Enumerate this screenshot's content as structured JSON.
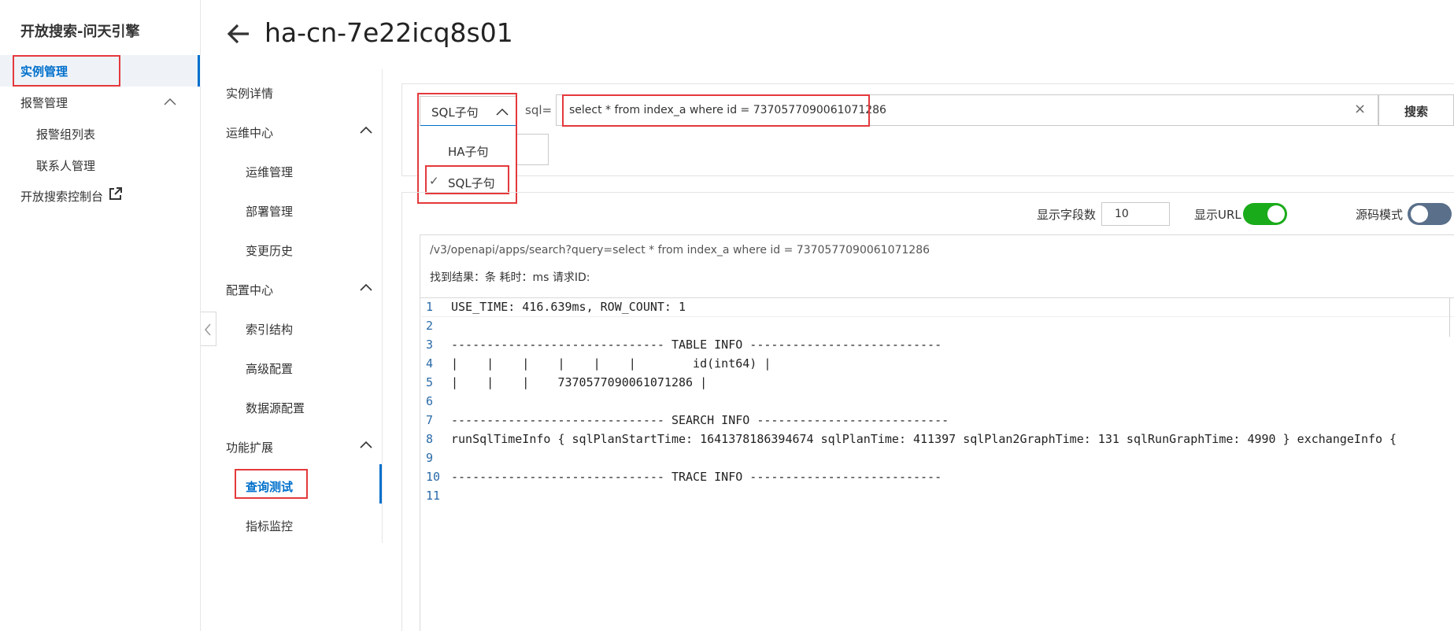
{
  "sidebar": {
    "brand": "开放搜索-问天引擎",
    "items": {
      "instance_mgmt": "实例管理",
      "alarm_mgmt": "报警管理",
      "alarm_groups": "报警组列表",
      "contacts": "联系人管理",
      "console": "开放搜索控制台"
    }
  },
  "header": {
    "title": "ha-cn-7e22icq8s01"
  },
  "subnav": {
    "instance_detail": "实例详情",
    "ops_center": "运维中心",
    "ops_mgmt": "运维管理",
    "deploy_mgmt": "部署管理",
    "change_history": "变更历史",
    "config_center": "配置中心",
    "index_structure": "索引结构",
    "advanced_config": "高级配置",
    "datasource_config": "数据源配置",
    "feature_ext": "功能扩展",
    "query_test": "查询测试",
    "metrics_monitor": "指标监控"
  },
  "query": {
    "selected_type": "SQL子句",
    "options": [
      "HA子句",
      "SQL子句"
    ],
    "check_mark": "✓",
    "sql_label": "sql=",
    "sql_value": "select * from index_a where id = 7370577090061071286",
    "clear_symbol": "×",
    "search_label": "搜索"
  },
  "result": {
    "fields_label": "显示字段数",
    "fields_value": "10",
    "show_url_label": "显示URL",
    "show_url_on": true,
    "source_mode_label": "源码模式",
    "source_mode_on": true,
    "url": "/v3/openapi/apps/search?query=select * from index_a where id = 7370577090061071286",
    "meta": "找到结果：条  耗时：ms  请求ID:",
    "code_lines": [
      {
        "n": "1",
        "text": "USE_TIME: 416.639ms, ROW_COUNT: 1"
      },
      {
        "n": "2",
        "text": ""
      },
      {
        "n": "3",
        "text": "------------------------------ TABLE INFO ---------------------------"
      },
      {
        "n": "4",
        "text": "|    |    |    |    |    |        id(int64) |"
      },
      {
        "n": "5",
        "text": "|    |    |    7370577090061071286 |"
      },
      {
        "n": "6",
        "text": ""
      },
      {
        "n": "7",
        "text": "------------------------------ SEARCH INFO ---------------------------"
      },
      {
        "n": "8",
        "text": "runSqlTimeInfo { sqlPlanStartTime: 1641378186394674 sqlPlanTime: 411397 sqlPlan2GraphTime: 131 sqlRunGraphTime: 4990 } exchangeInfo {"
      },
      {
        "n": "9",
        "text": ""
      },
      {
        "n": "10",
        "text": "------------------------------ TRACE INFO ---------------------------"
      },
      {
        "n": "11",
        "text": ""
      }
    ]
  },
  "colors": {
    "accent": "#0070cc",
    "toggle_on": "#1aab1a",
    "toggle_dark": "#5a6f8a",
    "highlight_box": "#e4393c"
  }
}
